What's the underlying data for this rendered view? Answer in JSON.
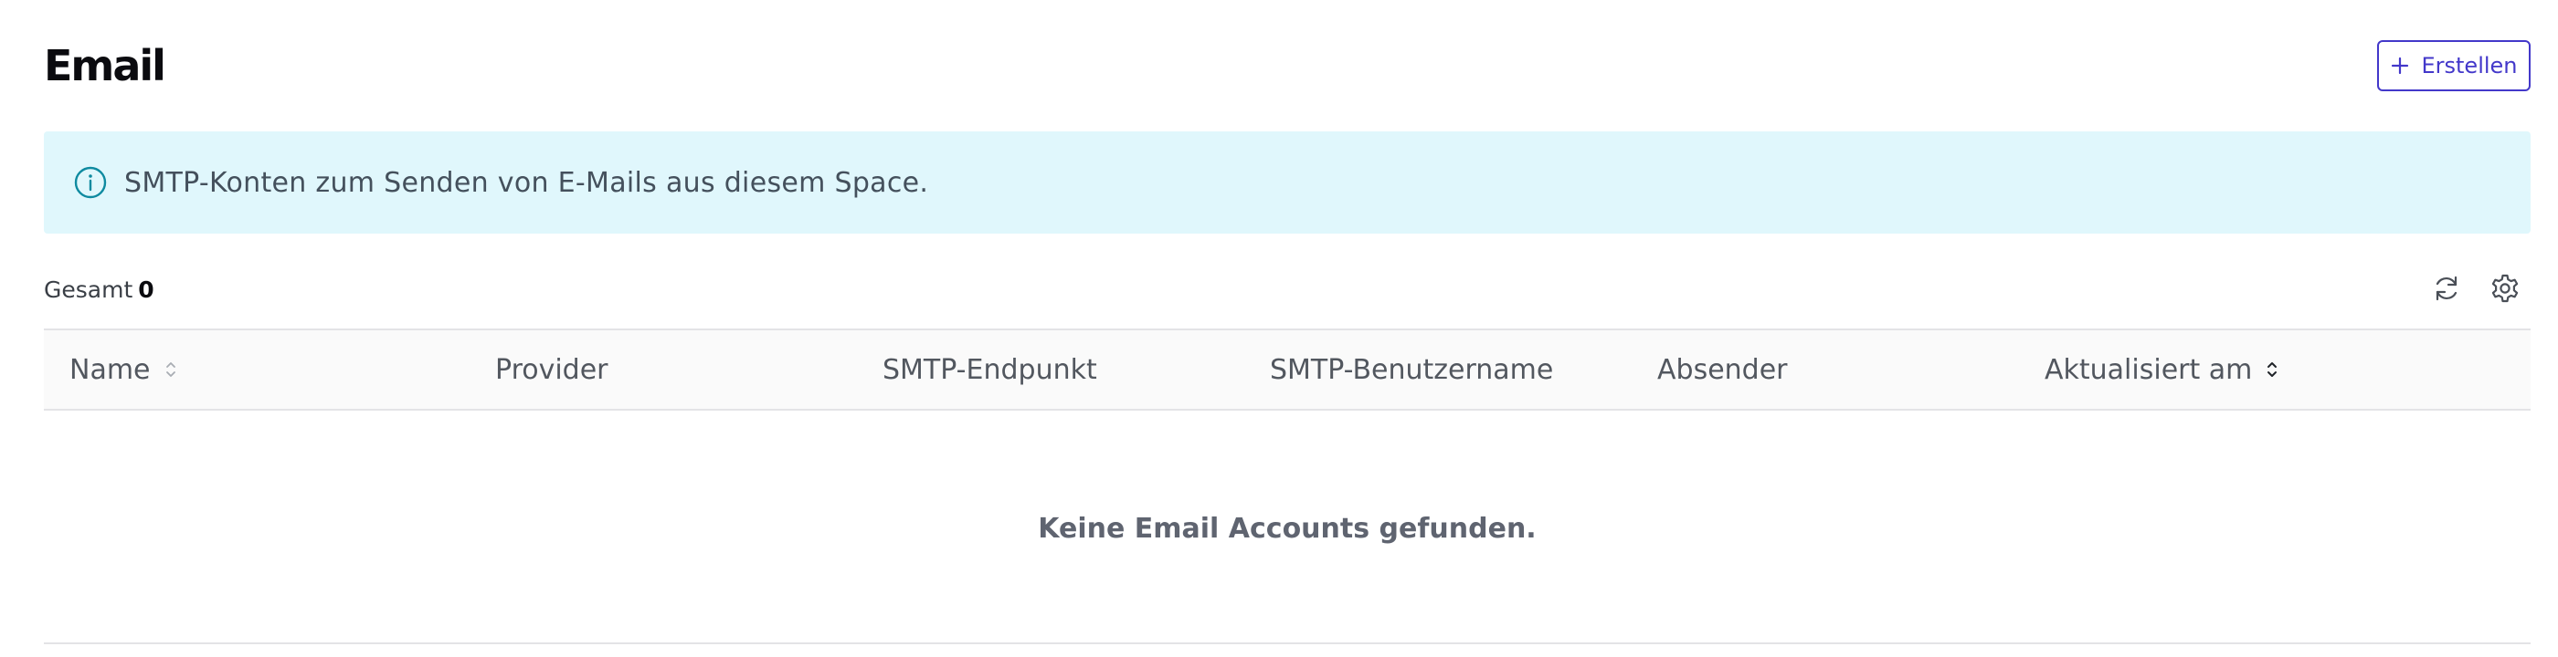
{
  "header": {
    "title": "Email",
    "create_label": "Erstellen"
  },
  "banner": {
    "text": "SMTP-Konten zum Senden von E-Mails aus diesem Space.",
    "icon": "info-icon"
  },
  "summary": {
    "total_label": "Gesamt",
    "total_count": "0"
  },
  "toolbar": {
    "refresh_icon": "refresh-icon",
    "settings_icon": "gear-icon"
  },
  "table": {
    "columns": [
      {
        "label": "Name",
        "sortable": true,
        "sort_state": "none"
      },
      {
        "label": "Provider",
        "sortable": false
      },
      {
        "label": "SMTP-Endpunkt",
        "sortable": false
      },
      {
        "label": "SMTP-Benutzername",
        "sortable": false
      },
      {
        "label": "Absender",
        "sortable": false
      },
      {
        "label": "Aktualisiert am",
        "sortable": true,
        "sort_state": "active"
      }
    ],
    "rows": [],
    "empty_message": "Keine Email Accounts gefunden."
  },
  "colors": {
    "accent": "#4338ca",
    "info_background": "#e0f7fc",
    "info_icon": "#0e8aa0",
    "header_background": "#fafafa",
    "border": "#e3e3e6"
  }
}
